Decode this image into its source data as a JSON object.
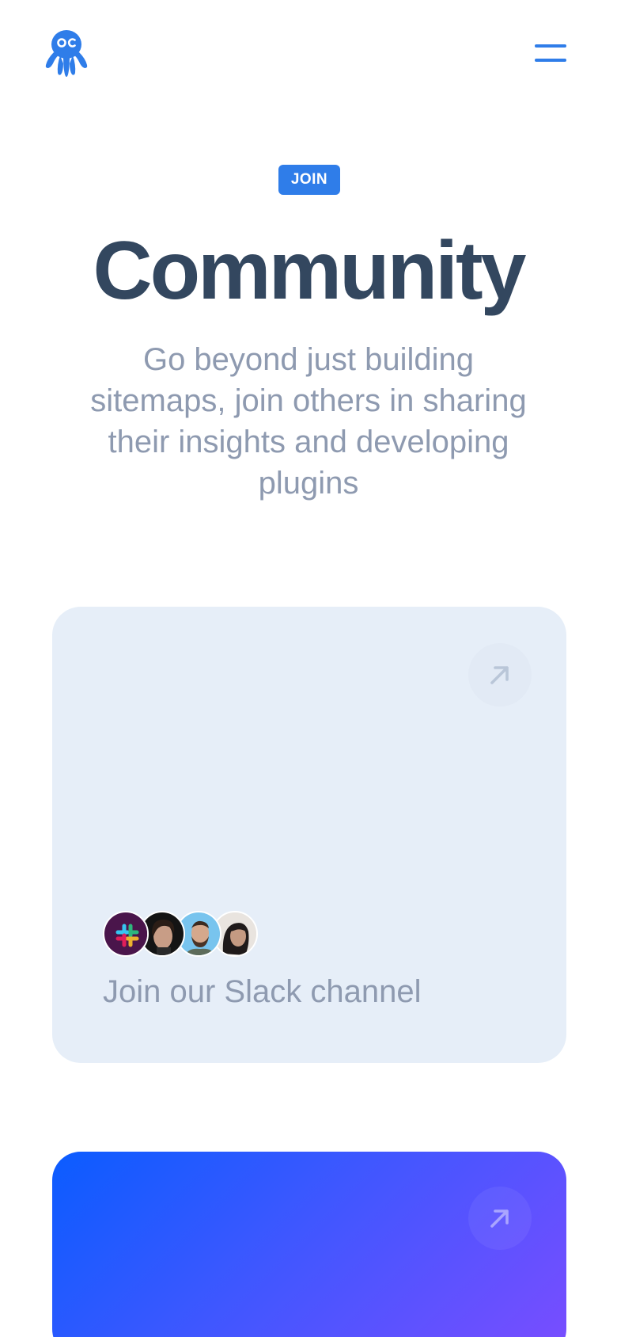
{
  "header": {
    "logo_icon": "octopus-logo-icon",
    "menu_icon": "hamburger-menu-icon"
  },
  "hero": {
    "badge": "JOIN",
    "title": "Community",
    "subtitle": "Go beyond just building sitemaps, join others in sharing their insights and developing plugins"
  },
  "cards": {
    "slack": {
      "label": "Join our Slack channel",
      "arrow_icon": "arrow-up-right-icon",
      "avatars": [
        "slack-logo-icon",
        "member-avatar",
        "member-avatar",
        "member-avatar"
      ]
    },
    "blue": {
      "arrow_icon": "arrow-up-right-icon"
    }
  },
  "colors": {
    "accent": "#2f7de9",
    "title": "#33475f",
    "muted_text": "#8e9ab0",
    "card_bg": "#e6eef8",
    "gradient_start": "#0b5cff",
    "gradient_end": "#7a4dff"
  }
}
